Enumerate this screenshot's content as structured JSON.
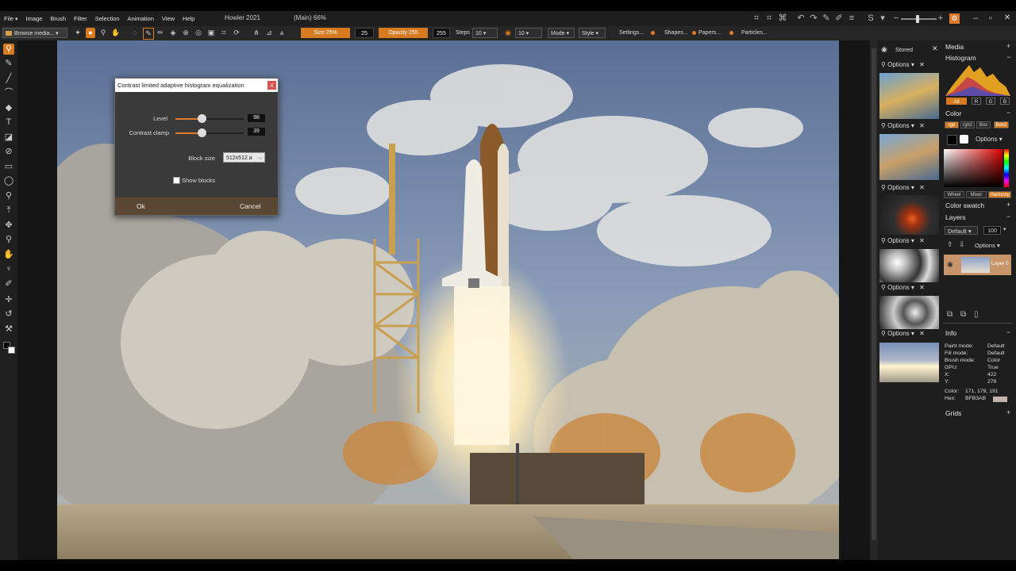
{
  "menu": {
    "items": [
      "File",
      "Image",
      "Brush",
      "Filter",
      "Selection",
      "Animation",
      "View",
      "Help"
    ],
    "app_title": "Howler 2021",
    "doc_title": "(Main)  66%"
  },
  "toolbar": {
    "browse_media": "Browse media...",
    "size": "Size 25%",
    "size_value": "25",
    "opacity": "Opacity 255",
    "opacity_value": "255",
    "steps_label": "Steps",
    "steps_value": "10",
    "steps2_value": "10",
    "mode": "Mode",
    "style": "Style",
    "settings": "Settings...",
    "shapes": "Shapes...",
    "papers": "Papers...",
    "particles": "Particles..."
  },
  "dialog": {
    "title": "Contrast limited adaptive histogram equalization",
    "level_label": "Level",
    "level_value": "98",
    "level_fraction": 0.39,
    "contrast_label": "Contrast clamp",
    "contrast_value": "39",
    "contrast_fraction": 0.39,
    "block_size_label": "Block size",
    "block_size_value": "512x512 a",
    "show_blocks_label": "Show blocks",
    "ok_label": "Ok",
    "cancel_label": "Cancel"
  },
  "stored": {
    "header": "Stored",
    "options_label": "Options"
  },
  "panels": {
    "media": "Media",
    "histogram": "Histogram",
    "hist_channels": [
      "All",
      "R",
      "G",
      "B"
    ],
    "color": "Color",
    "color_tabs": [
      "rgb",
      "rgb2",
      "Box",
      "Box2"
    ],
    "color_options": "Options",
    "color_mode_tabs": [
      "Wheel",
      "Mixer",
      "Harmony"
    ],
    "color_swatch": "Color swatch",
    "layers": "Layers",
    "layers_mode": "Default",
    "layers_opacity": "100",
    "layers_options": "Options",
    "layer_name": "Layer 0",
    "info": "Info",
    "grids": "Grids",
    "info_rows": [
      {
        "k": "Paint mode:",
        "v": "Default"
      },
      {
        "k": "Fill mode:",
        "v": "Default"
      },
      {
        "k": "Brush mode:",
        "v": "Color"
      },
      {
        "k": "GPU:",
        "v": "True"
      },
      {
        "k": "X:",
        "v": "422"
      },
      {
        "k": "Y:",
        "v": "279"
      },
      {
        "k": "Color:",
        "v": "171, 179, 191"
      },
      {
        "k": "Hex:",
        "v": "BFB3AB"
      }
    ]
  },
  "colors": {
    "accent": "#d87a20",
    "dialog_footer": "#5a4733"
  }
}
